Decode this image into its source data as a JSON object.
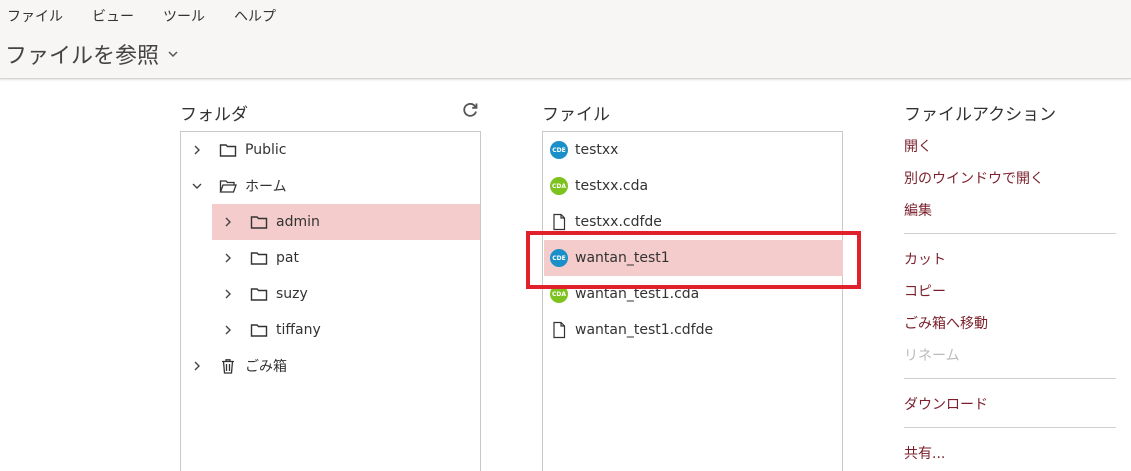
{
  "menu": [
    "ファイル",
    "ビュー",
    "ツール",
    "ヘルプ"
  ],
  "page_title": "ファイルを参照",
  "folders_panel": {
    "title": "フォルダ",
    "refresh_icon": "refresh-icon",
    "items": [
      {
        "label": "Public",
        "expanded": false,
        "icon": "folder-icon"
      },
      {
        "label": "ホーム",
        "expanded": true,
        "icon": "folder-open-icon"
      },
      {
        "label": "admin",
        "expanded": false,
        "selected": true,
        "icon": "folder-icon"
      },
      {
        "label": "pat",
        "expanded": false,
        "icon": "folder-icon"
      },
      {
        "label": "suzy",
        "expanded": false,
        "icon": "folder-icon"
      },
      {
        "label": "tiffany",
        "expanded": false,
        "icon": "folder-icon"
      },
      {
        "label": "ごみ箱",
        "expanded": false,
        "icon": "trash-icon"
      }
    ]
  },
  "files_panel": {
    "title": "ファイル",
    "items": [
      {
        "name": "testxx",
        "type": "CDE"
      },
      {
        "name": "testxx.cda",
        "type": "CDA"
      },
      {
        "name": "testxx.cdfde",
        "type": "file"
      },
      {
        "name": "wantan_test1",
        "type": "CDE",
        "selected": true
      },
      {
        "name": "wantan_test1.cda",
        "type": "CDA"
      },
      {
        "name": "wantan_test1.cdfde",
        "type": "file"
      }
    ]
  },
  "actions_panel": {
    "title": "ファイルアクション",
    "groups": [
      [
        "開く",
        "別のウインドウで開く",
        "編集"
      ],
      [
        "カット",
        "コピー",
        "ごみ箱へ移動",
        "リネーム"
      ],
      [
        "ダウンロード"
      ],
      [
        "共有..."
      ]
    ],
    "disabled": [
      "リネーム"
    ]
  },
  "colors": {
    "selected_bg": "#f3cccb",
    "action_link": "#7a1f2b",
    "highlight_border": "#e0202a",
    "cde_badge": "#1b8fc7",
    "cda_badge": "#7dc21e"
  }
}
